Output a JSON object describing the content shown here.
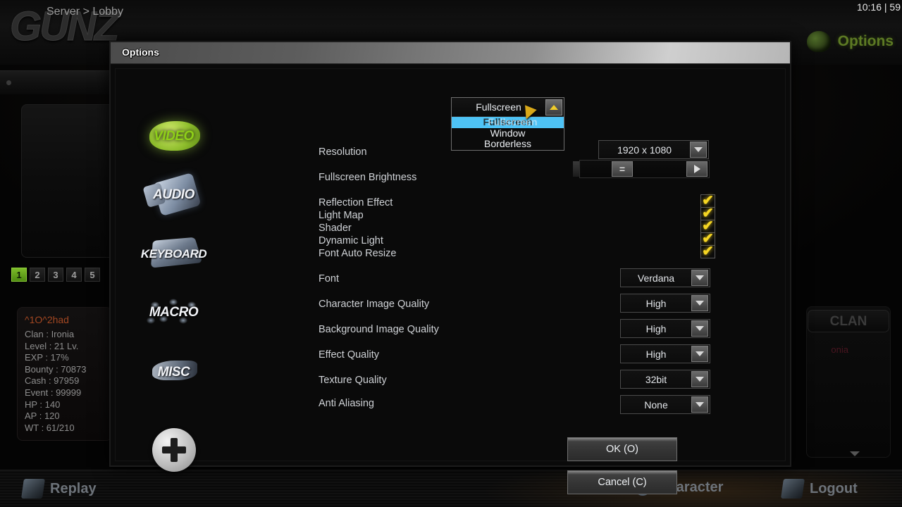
{
  "game": {
    "logo": "GUNZ",
    "clock": "10:16 | 59",
    "options_label": "Options",
    "breadcrumb": "Server > Lobby",
    "page_tabs": [
      "1",
      "2",
      "3",
      "4",
      "5"
    ],
    "player": {
      "name": "^1O^2had",
      "rows": [
        "Clan : Ironia",
        "Level : 21 Lv.",
        "EXP : 17%",
        "Bounty : 70873",
        "Cash : 97959",
        "Event : 99999",
        "HP : 140",
        "AP : 120",
        "WT : 61/210"
      ]
    },
    "clan_tab": "CLAN",
    "clan_name": "onia",
    "bottom_bar": {
      "replay": "Replay",
      "character": "Character",
      "logout": "Logout"
    }
  },
  "dialog": {
    "title": "Options",
    "categories": [
      {
        "label": "VIDEO"
      },
      {
        "label": "AUDIO"
      },
      {
        "label": "KEYBOARD"
      },
      {
        "label": "MACRO"
      },
      {
        "label": "MISC"
      }
    ],
    "rows": {
      "resolution_label": "Resolution",
      "brightness_label": "Fullscreen Brightness",
      "reflection_label": "Reflection Effect",
      "lightmap_label": "Light Map",
      "shader_label": "Shader",
      "dynamiclight_label": "Dynamic Light",
      "fontautoresize_label": "Font Auto Resize",
      "font_label": "Font",
      "charquality_label": "Character Image Quality",
      "bgquality_label": "Background Image Quality",
      "effectquality_label": "Effect Quality",
      "texturequality_label": "Texture Quality",
      "antialiasing_label": "Anti Aliasing"
    },
    "display_mode": {
      "value": "Fullscreen",
      "options": [
        "Fullscreen",
        "Window",
        "Borderless"
      ],
      "selected": "Fullscreen",
      "open": true
    },
    "resolution": {
      "value": "1920 x 1080"
    },
    "brightness": {
      "handle": "="
    },
    "checkboxes": [
      {
        "name": "reflection-effect",
        "checked": true,
        "mark": "✔"
      },
      {
        "name": "light-map",
        "checked": true,
        "mark": "✔"
      },
      {
        "name": "shader",
        "checked": true,
        "mark": "✔"
      },
      {
        "name": "dynamic-light",
        "checked": true,
        "mark": "✔"
      },
      {
        "name": "font-auto-resize",
        "checked": true,
        "mark": "✔"
      }
    ],
    "selects": {
      "font": "Verdana",
      "character_image_quality": "High",
      "background_image_quality": "High",
      "effect_quality": "High",
      "texture_quality": "32bit",
      "anti_aliasing": "None"
    },
    "buttons": {
      "ok": "OK (O)",
      "cancel": "Cancel (C)"
    }
  },
  "colors": {
    "accent_green": "#8ed018",
    "highlight_blue": "#4ec3f5",
    "check_yellow": "#f5d523",
    "gold_arrow": "#f0cc2a"
  }
}
